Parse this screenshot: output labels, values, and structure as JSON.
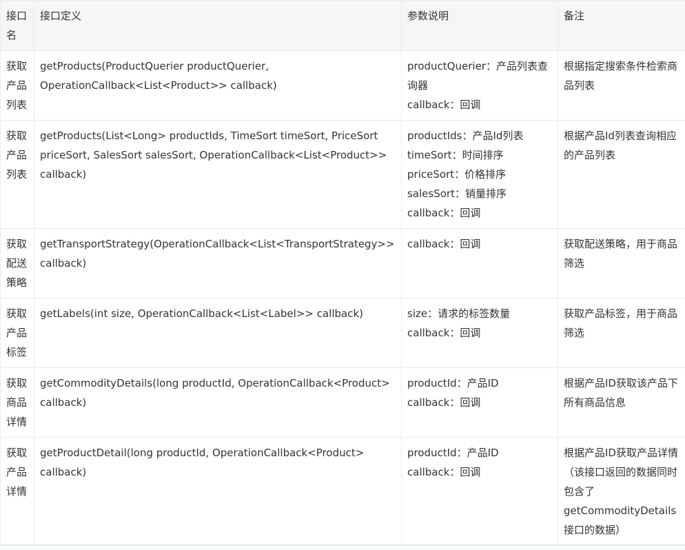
{
  "table": {
    "headers": {
      "name": "接口名",
      "definition": "接口定义",
      "params": "参数说明",
      "notes": "备注"
    },
    "rows": [
      {
        "name": "获取产品列表",
        "definition": "getProducts(ProductQuerier productQuerier, OperationCallback<List<Product>> callback)",
        "params": [
          "productQuerier：产品列表查询器",
          "callback：回调"
        ],
        "notes": "根据指定搜索条件检索商品列表"
      },
      {
        "name": "获取产品列表",
        "definition": "getProducts(List<Long> productIds, TimeSort timeSort, PriceSort priceSort, SalesSort salesSort, OperationCallback<List<Product>> callback)",
        "params": [
          "productIds：产品Id列表",
          "timeSort：时间排序",
          "priceSort：价格排序",
          "salesSort：销量排序",
          "callback：回调"
        ],
        "notes": "根据产品Id列表查询相应的产品列表"
      },
      {
        "name": "获取配送策略",
        "definition": "getTransportStrategy(OperationCallback<List<TransportStrategy>> callback)",
        "params": [
          "callback：回调"
        ],
        "notes": "获取配送策略，用于商品筛选"
      },
      {
        "name": "获取产品标签",
        "definition": "getLabels(int size, OperationCallback<List<Label>> callback)",
        "params": [
          "size：请求的标签数量",
          "callback：回调"
        ],
        "notes": "获取产品标签，用于商品筛选"
      },
      {
        "name": "获取商品详情",
        "definition": "getCommodityDetails(long productId, OperationCallback<Product> callback)",
        "params": [
          "productId：产品ID",
          "callback：回调"
        ],
        "notes": "根据产品ID获取该产品下所有商品信息"
      },
      {
        "name": "获取产品详情",
        "definition": "getProductDetail(long productId, OperationCallback<Product> callback)",
        "params": [
          "productId：产品ID",
          "callback：回调"
        ],
        "notes": "根据产品ID获取产品详情（该接口返回的数据同时包含了getCommodityDetails接口的数据）"
      }
    ]
  }
}
